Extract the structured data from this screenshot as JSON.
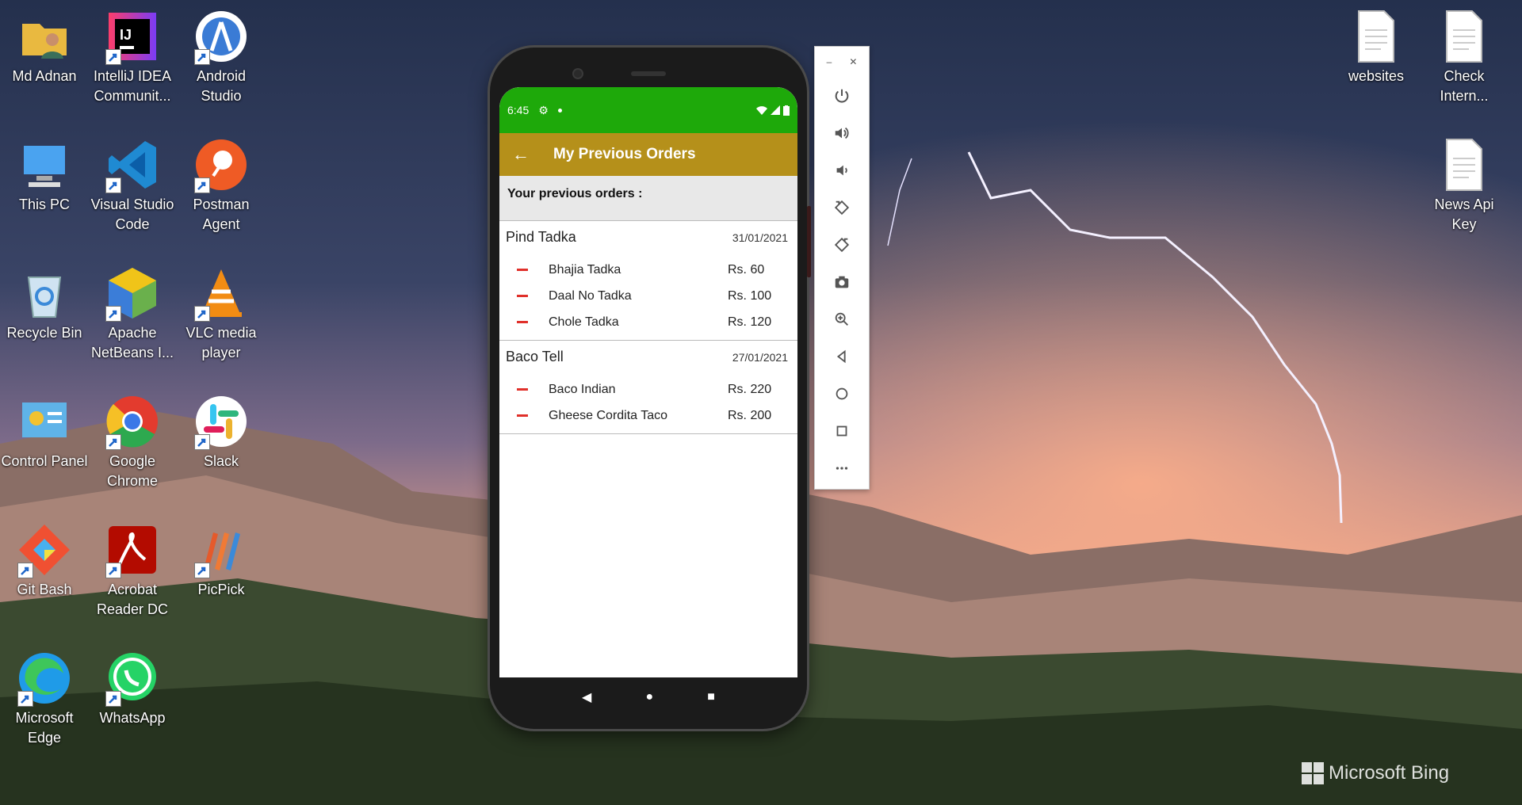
{
  "desktop": {
    "icons_left": [
      {
        "label": "Md Adnan",
        "icon": "folder-user-icon"
      },
      {
        "label": "IntelliJ IDEA Communit...",
        "icon": "intellij-icon"
      },
      {
        "label": "Android Studio",
        "icon": "android-studio-icon"
      },
      {
        "label": "This PC",
        "icon": "this-pc-icon"
      },
      {
        "label": "Visual Studio Code",
        "icon": "vscode-icon"
      },
      {
        "label": "Postman Agent",
        "icon": "postman-icon"
      },
      {
        "label": "Recycle Bin",
        "icon": "recycle-bin-icon"
      },
      {
        "label": "Apache NetBeans I...",
        "icon": "netbeans-icon"
      },
      {
        "label": "VLC media player",
        "icon": "vlc-icon"
      },
      {
        "label": "Control Panel",
        "icon": "control-panel-icon"
      },
      {
        "label": "Google Chrome",
        "icon": "chrome-icon"
      },
      {
        "label": "Slack",
        "icon": "slack-icon"
      },
      {
        "label": "Git Bash",
        "icon": "git-bash-icon"
      },
      {
        "label": "Acrobat Reader DC",
        "icon": "acrobat-icon"
      },
      {
        "label": "PicPick",
        "icon": "picpick-icon"
      },
      {
        "label": "Microsoft Edge",
        "icon": "edge-icon"
      },
      {
        "label": "WhatsApp",
        "icon": "whatsapp-icon"
      }
    ],
    "icons_right": [
      {
        "label": "websites",
        "icon": "text-file-icon"
      },
      {
        "label": "Check Intern...",
        "icon": "text-file-icon"
      },
      {
        "label": "News Api Key",
        "icon": "text-file-icon"
      }
    ],
    "watermark": "Microsoft Bing"
  },
  "phone": {
    "status_time": "6:45",
    "appbar_title": "My Previous Orders",
    "subheader": "Your previous orders :",
    "orders": [
      {
        "restaurant": "Pind Tadka",
        "date": "31/01/2021",
        "items": [
          {
            "name": "Bhajia Tadka",
            "price": "Rs. 60"
          },
          {
            "name": "Daal No Tadka",
            "price": "Rs. 100"
          },
          {
            "name": "Chole Tadka",
            "price": "Rs. 120"
          }
        ]
      },
      {
        "restaurant": "Baco Tell",
        "date": "27/01/2021",
        "items": [
          {
            "name": "Baco Indian",
            "price": "Rs. 220"
          },
          {
            "name": "Gheese Cordita Taco",
            "price": "Rs. 200"
          }
        ]
      }
    ],
    "colors": {
      "statusbar": "#1ea90a",
      "appbar": "#b5901a",
      "dash": "#e0302a"
    }
  },
  "emulator_toolbar": {
    "buttons": [
      "power-icon",
      "volume-up-icon",
      "volume-down-icon",
      "rotate-left-icon",
      "rotate-right-icon",
      "camera-icon",
      "zoom-icon",
      "back-icon",
      "home-icon",
      "overview-icon",
      "more-icon"
    ]
  }
}
